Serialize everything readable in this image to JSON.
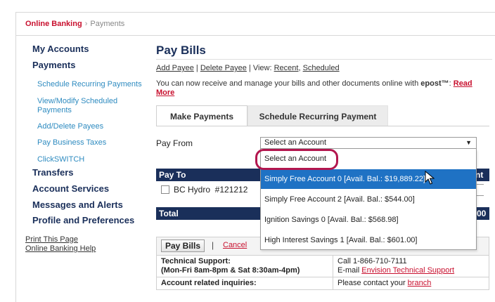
{
  "breadcrumb": {
    "home": "Online Banking",
    "separator": "›",
    "current": "Payments"
  },
  "sidebar": {
    "sections": [
      {
        "label": "My Accounts"
      },
      {
        "label": "Payments"
      },
      {
        "label": "Transfers"
      },
      {
        "label": "Account Services"
      },
      {
        "label": "Messages and Alerts"
      },
      {
        "label": "Profile and Preferences"
      }
    ],
    "payments_sub": [
      {
        "label": "Schedule Recurring Payments"
      },
      {
        "label": "View/Modify Scheduled Payments"
      },
      {
        "label": "Add/Delete Payees"
      },
      {
        "label": "Pay Business Taxes"
      },
      {
        "label": "ClickSWITCH"
      }
    ],
    "print": "Print This Page",
    "help": "Online Banking Help"
  },
  "main": {
    "title": "Pay Bills",
    "links": {
      "add_payee": "Add Payee",
      "delete_payee": "Delete Payee",
      "view_label": "View:",
      "recent": "Recent",
      "scheduled": "Scheduled"
    },
    "notice": {
      "text": "You can now receive and manage your bills and other documents online with ",
      "brand": "epost™",
      "colon": ": ",
      "read_more": "Read More"
    },
    "tabs": [
      {
        "label": "Make Payments"
      },
      {
        "label": "Schedule Recurring Payment"
      }
    ],
    "pay_from_label": "Pay From",
    "select_value": "Select an Account",
    "dropdown_options": [
      {
        "label": "Select an Account"
      },
      {
        "label": "Simply Free Account 0 [Avail. Bal.: $19,889.22]"
      },
      {
        "label": "Simply Free Account 2 [Avail. Bal.: $544.00]"
      },
      {
        "label": "Ignition Savings 0 [Avail. Bal.: $568.98]"
      },
      {
        "label": "High Interest Savings 1 [Avail. Bal.: $601.00]"
      }
    ],
    "table": {
      "pay_to_header": "Pay To",
      "right_header_fragment": "nt",
      "payee": "BC Hydro  #121212",
      "total_label": "Total",
      "total_fragment": "00"
    },
    "actions": {
      "pay_bills": "Pay Bills",
      "separator": "|",
      "cancel": "Cancel"
    },
    "support": {
      "tech_label_1": "Technical Support:",
      "tech_label_2": "(Mon-Fri 8am-8pm & Sat 8:30am-4pm)",
      "tech_call": "Call 1-866-710-7111",
      "tech_email_prefix": "E-mail ",
      "tech_email_link": "Envision Technical Support",
      "acct_label": "Account related inquiries:",
      "acct_text": "Please contact your ",
      "acct_link": "branch"
    }
  },
  "colors": {
    "brand_red": "#c8102e",
    "navy": "#1a2f5a",
    "link_blue": "#2e8bc0",
    "selected_blue": "#1f72c4",
    "ring": "#b3164e"
  }
}
